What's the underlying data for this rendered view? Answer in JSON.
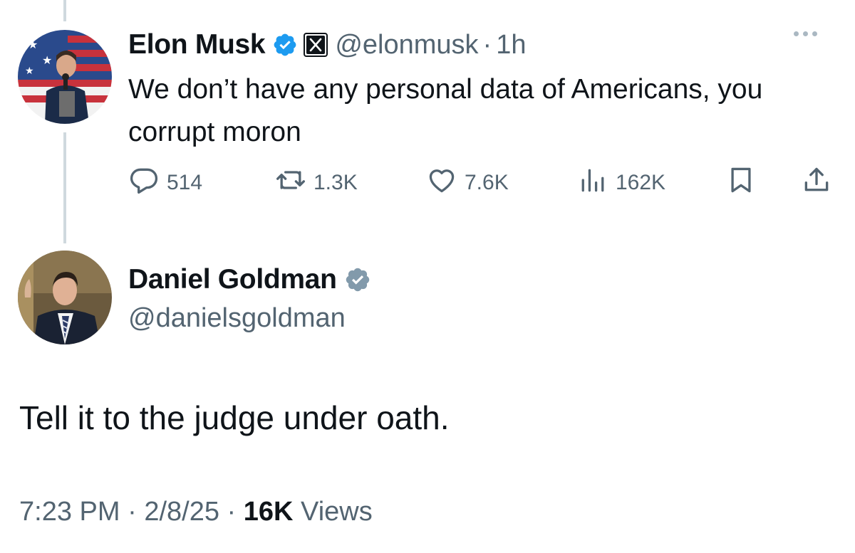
{
  "parent_tweet": {
    "author_name": "Elon Musk",
    "handle": "@elonmusk",
    "separator": "·",
    "time_ago": "1h",
    "text": "We don’t have any personal data of Americans, you corrupt moron",
    "stats": {
      "replies": "514",
      "retweets": "1.3K",
      "likes": "7.6K",
      "views": "162K"
    }
  },
  "reply_tweet": {
    "author_name": "Daniel Goldman",
    "handle": "@danielsgoldman",
    "text": "Tell it to the judge under oath.",
    "time": "7:23 PM",
    "separator": "·",
    "date": "2/8/25",
    "views_count": "16K",
    "views_label": "Views"
  },
  "icons": {
    "verified_badge": "verified-badge-icon",
    "x_affiliation": "x-logo-icon",
    "more": "more-icon",
    "reply": "reply-icon",
    "retweet": "retweet-icon",
    "like": "like-icon",
    "views": "views-icon",
    "bookmark": "bookmark-icon",
    "share": "share-icon"
  },
  "colors": {
    "text_primary": "#0f1419",
    "text_secondary": "#536471",
    "verified_blue": "#1d9bf0",
    "verified_gray": "#829aab",
    "thread_line": "#cfd9de"
  }
}
